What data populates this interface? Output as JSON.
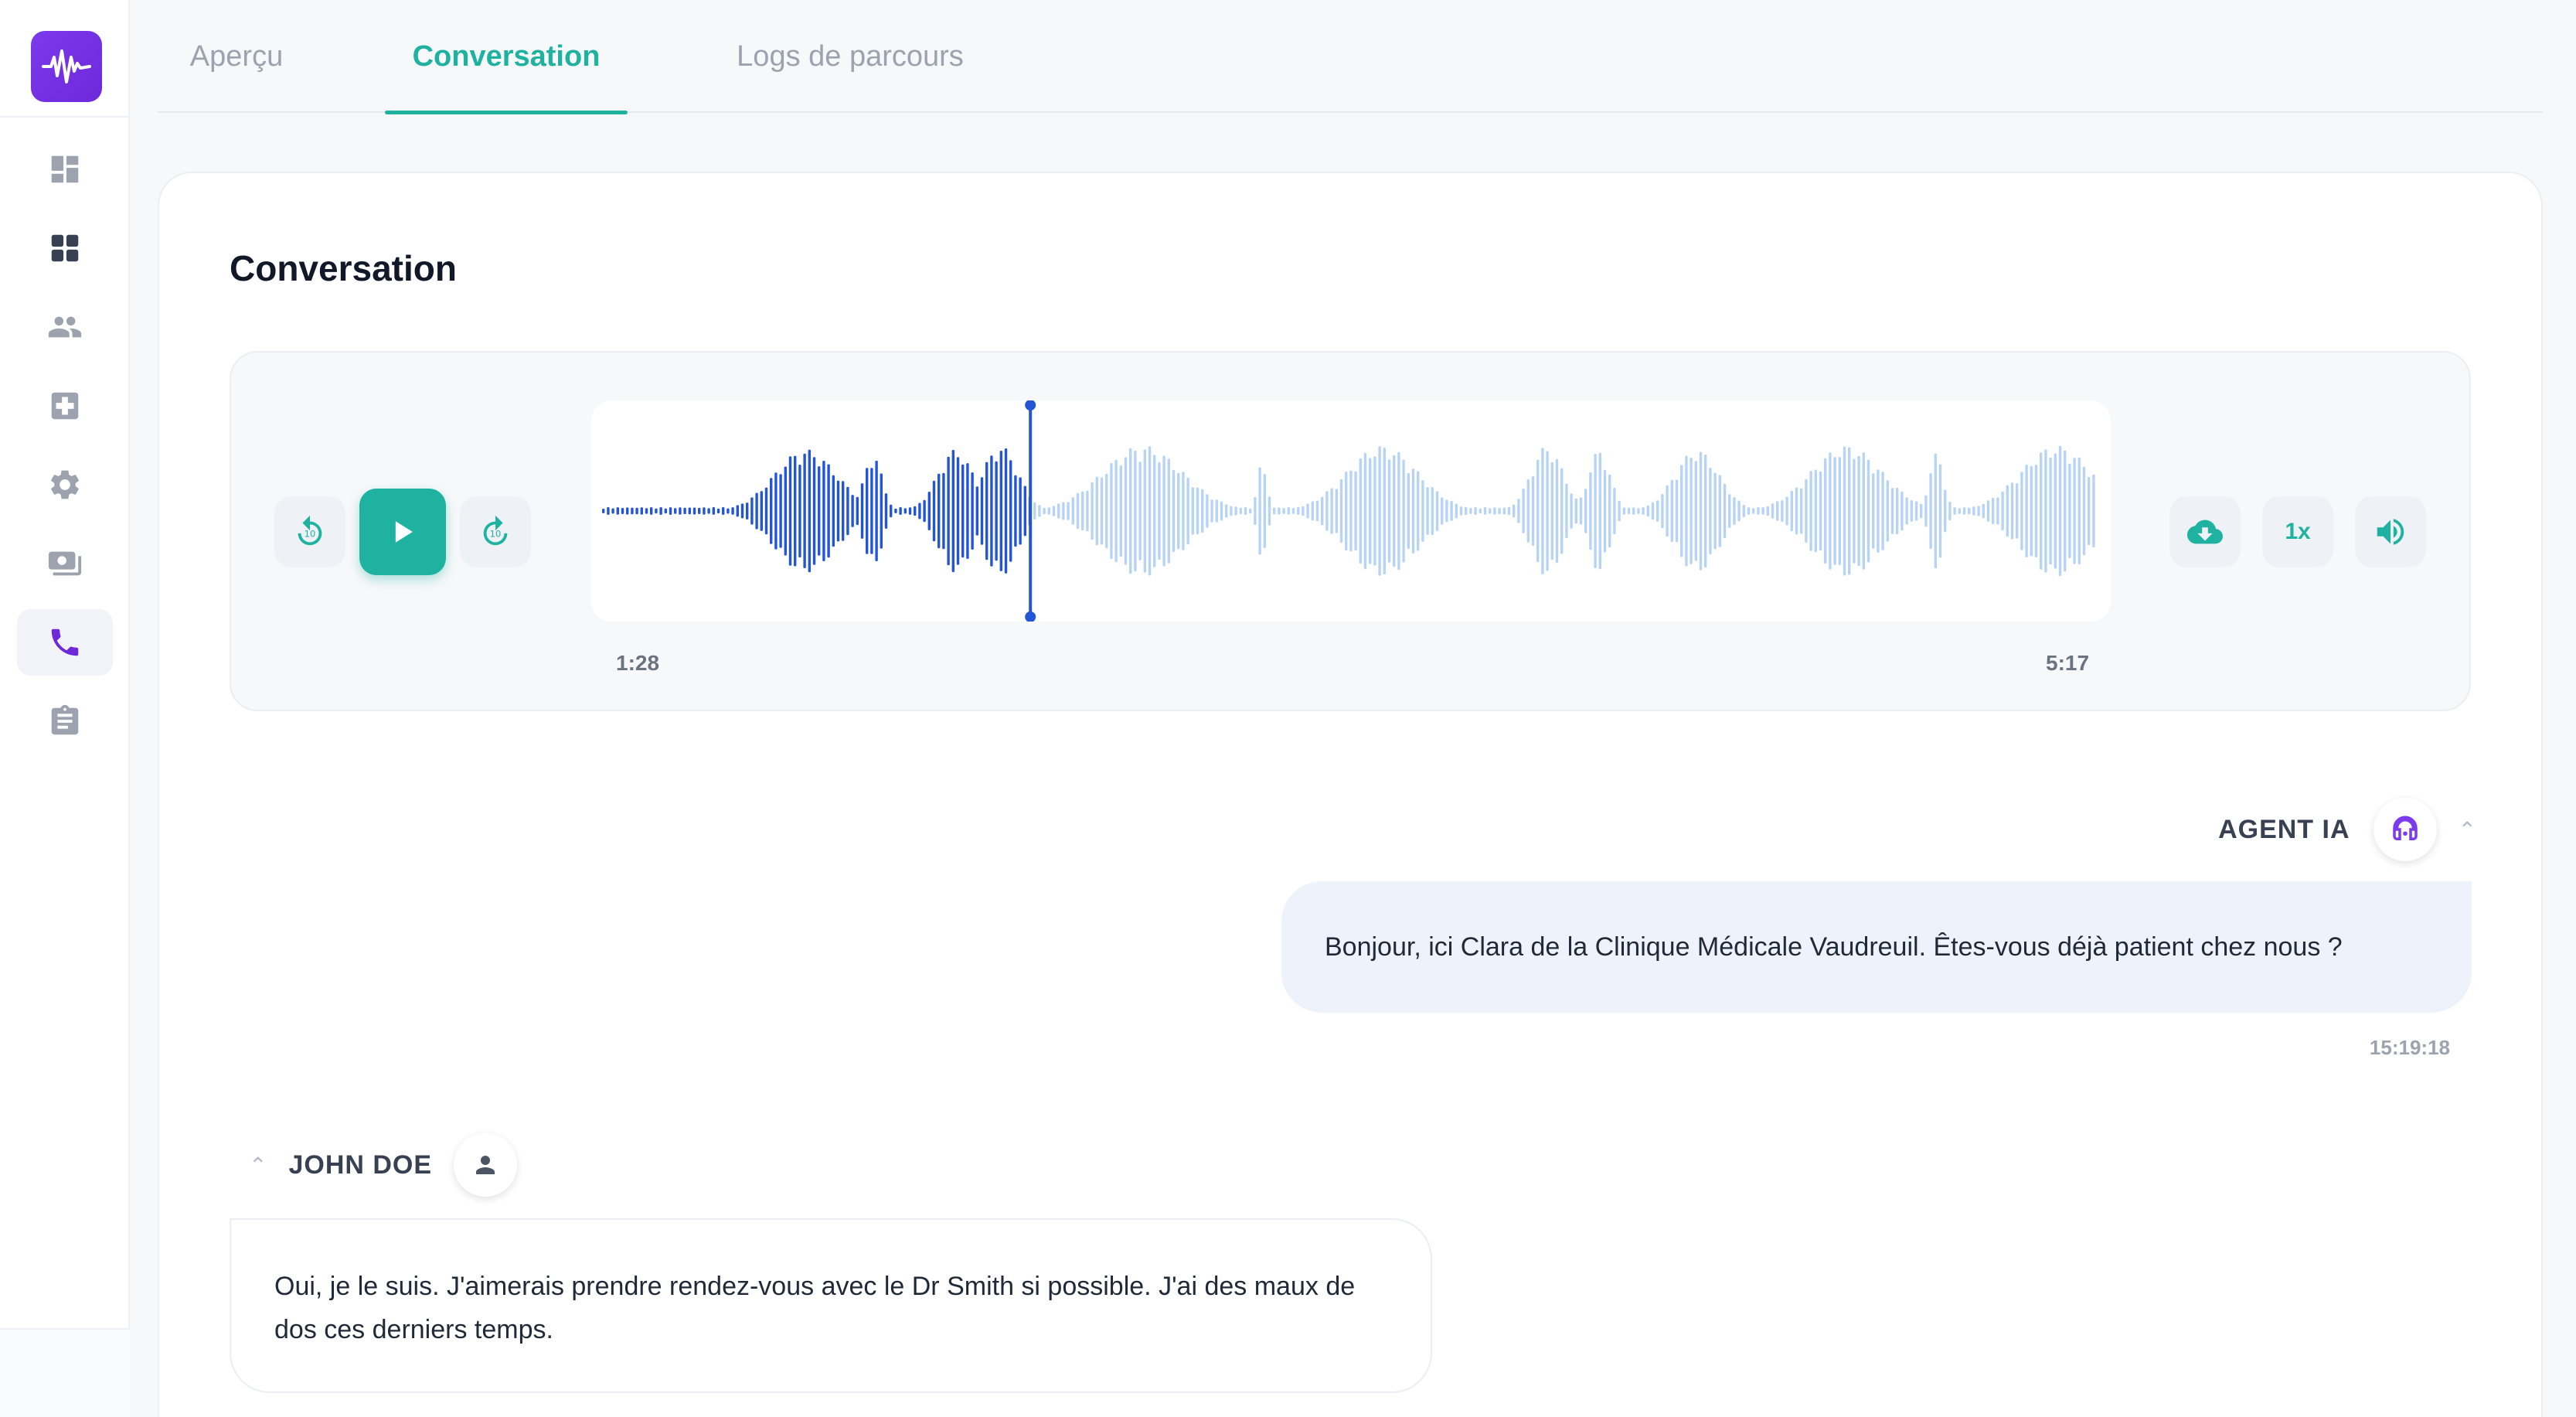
{
  "tabs": [
    {
      "label": "Aperçu",
      "active": false
    },
    {
      "label": "Conversation",
      "active": true
    },
    {
      "label": "Logs de parcours",
      "active": false
    }
  ],
  "sidebar": {
    "items": [
      {
        "icon": "dashboard-icon",
        "active": false
      },
      {
        "icon": "grid-icon",
        "active": false
      },
      {
        "icon": "users-icon",
        "active": false
      },
      {
        "icon": "medical-icon",
        "active": false
      },
      {
        "icon": "gear-icon",
        "active": false
      },
      {
        "icon": "payments-icon",
        "active": false
      },
      {
        "icon": "phone-icon",
        "active": true
      },
      {
        "icon": "clipboard-icon",
        "active": false
      }
    ]
  },
  "card": {
    "title": "Conversation"
  },
  "player": {
    "current_time": "1:28",
    "total_time": "5:17",
    "progress": 0.2777,
    "speed": "1x"
  },
  "messages": [
    {
      "speaker": "AGENT IA",
      "text": "Bonjour, ici Clara de la Clinique Médicale Vaudreuil. Êtes-vous déjà patient chez nous ?",
      "time": "15:19:18"
    },
    {
      "speaker": "JOHN DOE",
      "text": "Oui, je le suis. J'aimerais prendre rendez-vous avec le Dr Smith si possible. J'ai des maux de dos ces derniers temps."
    }
  ],
  "colors": {
    "accent": "#20b2a0",
    "brand": "#6d28d9",
    "wave_played": "#2355d6",
    "wave_unplayed": "#b8d4f5"
  }
}
